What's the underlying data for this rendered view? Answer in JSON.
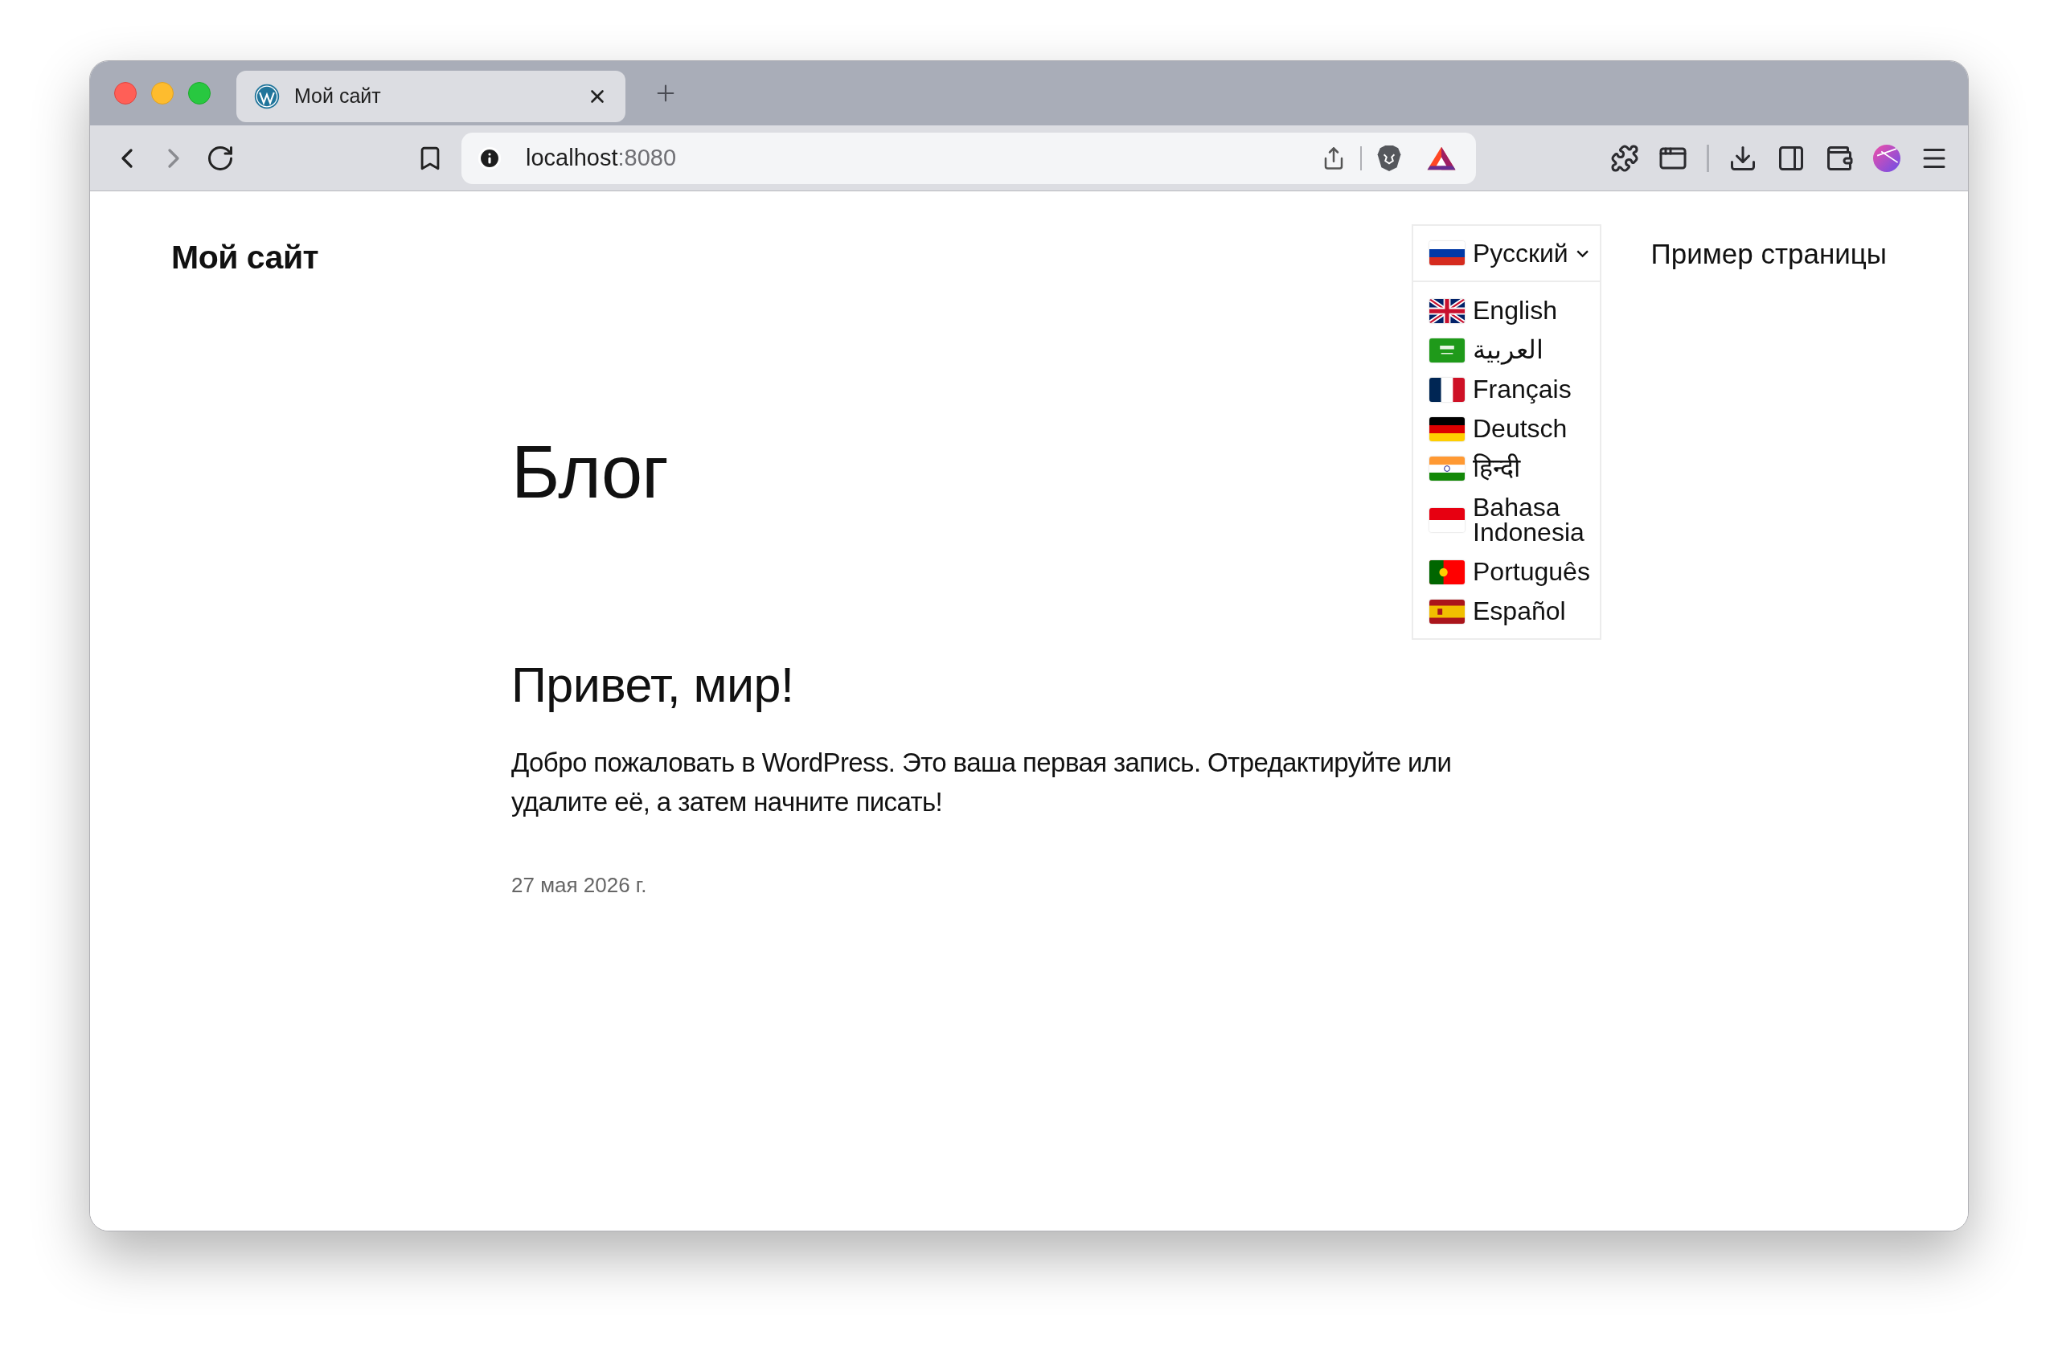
{
  "tab": {
    "title": "Мой сайт"
  },
  "address_bar": {
    "host": "localhost",
    "port": ":8080"
  },
  "site": {
    "title": "Мой сайт"
  },
  "language_switcher": {
    "current": "Русский",
    "expanded": true,
    "options": [
      {
        "label": "English"
      },
      {
        "label": "العربية"
      },
      {
        "label": "Français"
      },
      {
        "label": "Deutsch"
      },
      {
        "label": "हिन्दी"
      },
      {
        "label": "Bahasa Indonesia"
      },
      {
        "label": "Português"
      },
      {
        "label": "Español"
      }
    ]
  },
  "nav": [
    "Пример страницы"
  ],
  "page": {
    "title": "Блог"
  },
  "post": {
    "title": "Привет, мир!",
    "excerpt": "Добро пожаловать в WordPress. Это ваша первая запись. Отредактируйте или удалите её, а затем начните писать!",
    "date": "27 мая 2026 г."
  }
}
